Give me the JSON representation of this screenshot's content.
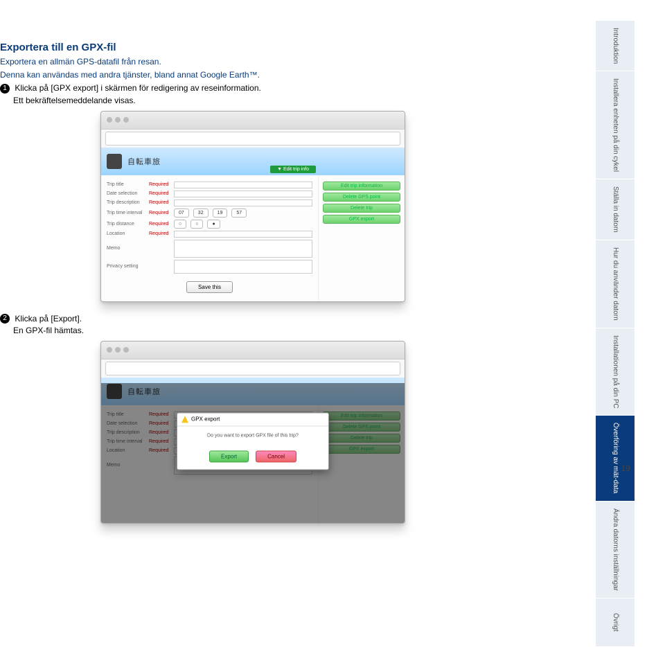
{
  "heading": "Exportera till en GPX-fil",
  "intro_line1": "Exportera en allmän GPS-datafil från resan.",
  "intro_line2": "Denna kan användas med andra tjänster, bland annat Google Earth™.",
  "step1": {
    "num": "1",
    "text": "Klicka på [GPX export] i skärmen för redigering av reseinformation.",
    "sub": "Ett bekräftelsemeddelande visas."
  },
  "step2": {
    "num": "2",
    "text": "Klicka på [Export].",
    "sub": "En GPX-fil hämtas."
  },
  "screenshot": {
    "banner_text": "自転車旅",
    "tag": "▼ Edit trip info",
    "side_items": [
      "Edit trip information",
      "Delete GPS point",
      "Delete trip",
      "GPX export"
    ],
    "form_labels": [
      "Trip title",
      "Date selection",
      "Trip description",
      "Trip time interval",
      "Trip distance",
      "Location",
      "Memo",
      "Privacy setting"
    ],
    "required": "Required",
    "save": "Save this"
  },
  "modal": {
    "title": "GPX export",
    "export": "Export",
    "cancel": "Cancel"
  },
  "tabs": [
    {
      "label": "Introduktion",
      "active": false
    },
    {
      "label": "Installera enheten på din cykel",
      "active": false
    },
    {
      "label": "Ställa in datorn",
      "active": false
    },
    {
      "label": "Hur du använder datorn",
      "active": false
    },
    {
      "label": "Installationen på din PC",
      "active": false
    },
    {
      "label": "Överföring av mät-data",
      "active": true
    },
    {
      "label": "Ändra datorns inställningar",
      "active": false
    },
    {
      "label": "Övrigt",
      "active": false
    }
  ],
  "page_number": "19"
}
